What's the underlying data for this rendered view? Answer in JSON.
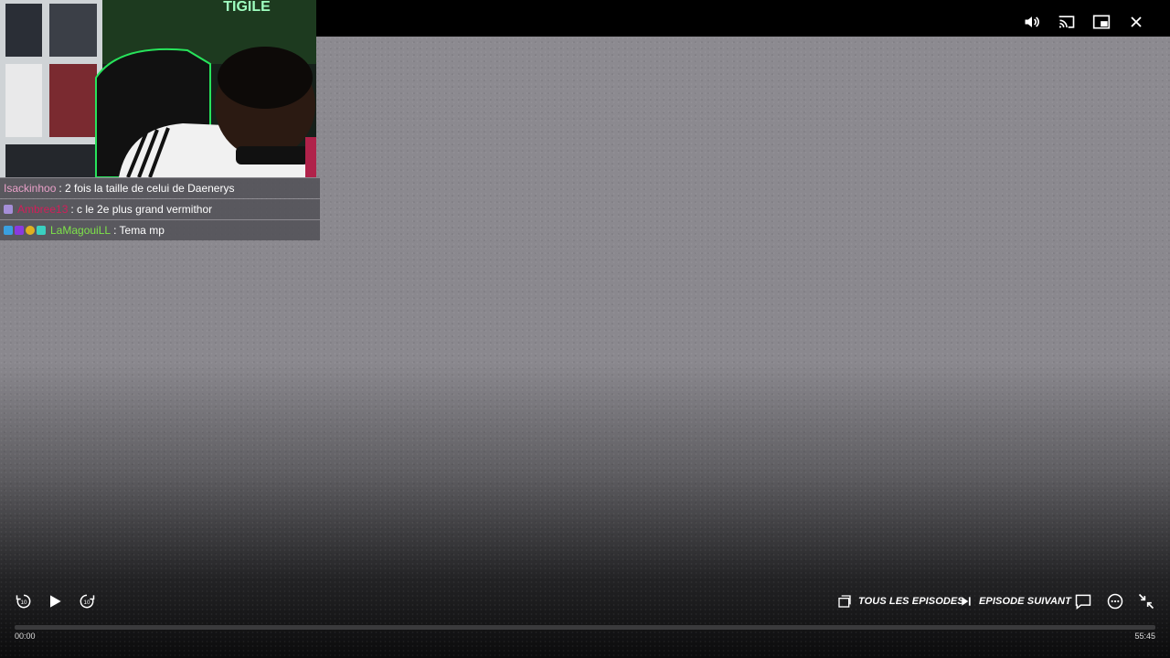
{
  "player": {
    "progress_fraction": 0.0,
    "current_time": "00:00",
    "duration": "55:45",
    "episodes_label": "TOUS LES EPISODES",
    "next_label": "EPISODE SUIVANT"
  },
  "top_controls": {
    "icons": [
      "volume-icon",
      "cast-icon",
      "picture-in-picture-icon",
      "close-icon"
    ]
  },
  "webcam": {
    "neon_sign": "TIGILE"
  },
  "chat": {
    "messages": [
      {
        "user": "Isackinhoo",
        "user_color": "#e8a0c8",
        "text": ": 2 fois la taille de celui de Daenerys"
      },
      {
        "user": "Ambree13",
        "user_color": "#d21e5a",
        "text": ": c le 2e plus grand vermithor"
      },
      {
        "user": "LaMagouiLL",
        "user_color": "#7ee34a",
        "text": ": Tema mp"
      }
    ]
  },
  "colors": {
    "accent": "#ffffff",
    "webcam_neon": "#27e35b"
  }
}
